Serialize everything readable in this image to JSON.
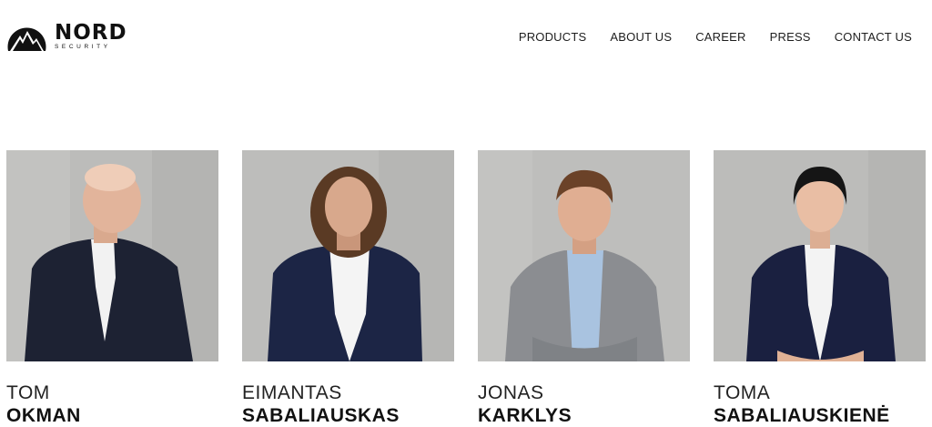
{
  "brand": {
    "name": "NORD",
    "sub": "SECURITY"
  },
  "nav": [
    {
      "label": "PRODUCTS"
    },
    {
      "label": "ABOUT US"
    },
    {
      "label": "CAREER"
    },
    {
      "label": "PRESS"
    },
    {
      "label": "CONTACT US"
    }
  ],
  "people": [
    {
      "first": "TOM",
      "last": "OKMAN",
      "photo": "portrait-bald-man-dark-suit"
    },
    {
      "first": "EIMANTAS",
      "last": "SABALIAUSKAS",
      "photo": "portrait-long-hair-man-navy-suit"
    },
    {
      "first": "JONAS",
      "last": "KARKLYS",
      "photo": "portrait-man-grey-check-blazer"
    },
    {
      "first": "TOMA",
      "last": "SABALIAUSKIENĖ",
      "photo": "portrait-woman-navy-blazer"
    }
  ],
  "colors": {
    "background": "#ffffff",
    "text": "#111111",
    "photo_wall": "#b9b9b7"
  }
}
